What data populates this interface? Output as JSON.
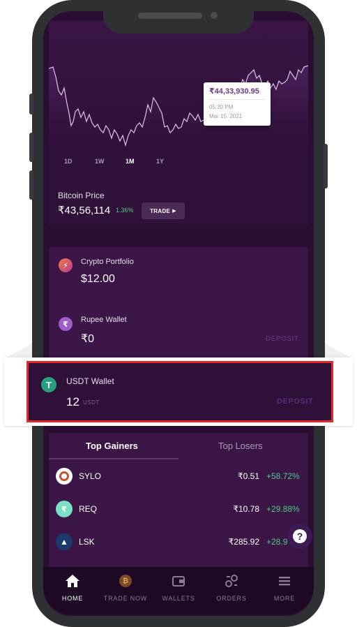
{
  "chart": {
    "tooltip_price": "₹44,33,930.95",
    "tooltip_time": "05:30 PM",
    "tooltip_date": "Mar 15, 2021",
    "timeframes": [
      "1D",
      "1W",
      "1M",
      "1Y"
    ],
    "active_timeframe": "1M"
  },
  "bitcoin": {
    "label": "Bitcoin Price",
    "price": "₹43,56,114",
    "change": "1.36%",
    "trade_label": "TRADE"
  },
  "wallets": {
    "crypto": {
      "title": "Crypto Portfolio",
      "amount": "$12.00"
    },
    "rupee": {
      "title": "Rupee Wallet",
      "amount": "₹0",
      "action": "DEPOSIT"
    },
    "usdt": {
      "title": "USDT Wallet",
      "amount": "12",
      "unit": "USDT",
      "action": "DEPOSIT"
    }
  },
  "market": {
    "tabs": [
      "Top Gainers",
      "Top Losers"
    ],
    "active_tab": "Top Gainers",
    "rows": [
      {
        "symbol": "SYLO",
        "price": "₹0.51",
        "change": "+58.72%",
        "icon": "sylo-icon"
      },
      {
        "symbol": "REQ",
        "price": "₹10.78",
        "change": "+29.88%",
        "icon": "req-icon"
      },
      {
        "symbol": "LSK",
        "price": "₹285.92",
        "change": "+28.9",
        "icon": "lsk-icon"
      }
    ]
  },
  "nav": {
    "items": [
      {
        "label": "HOME",
        "icon": "home-icon"
      },
      {
        "label": "TRADE NOW",
        "icon": "bitcoin-icon"
      },
      {
        "label": "WALLETS",
        "icon": "wallet-icon"
      },
      {
        "label": "ORDERS",
        "icon": "orders-icon"
      },
      {
        "label": "MORE",
        "icon": "menu-icon"
      }
    ],
    "active": "HOME"
  },
  "colors": {
    "background": "#2a0d33",
    "card": "#3a1545",
    "positive": "#4fc98a",
    "highlight_border": "#e12a2a",
    "deposit": "#5c2d7a"
  }
}
